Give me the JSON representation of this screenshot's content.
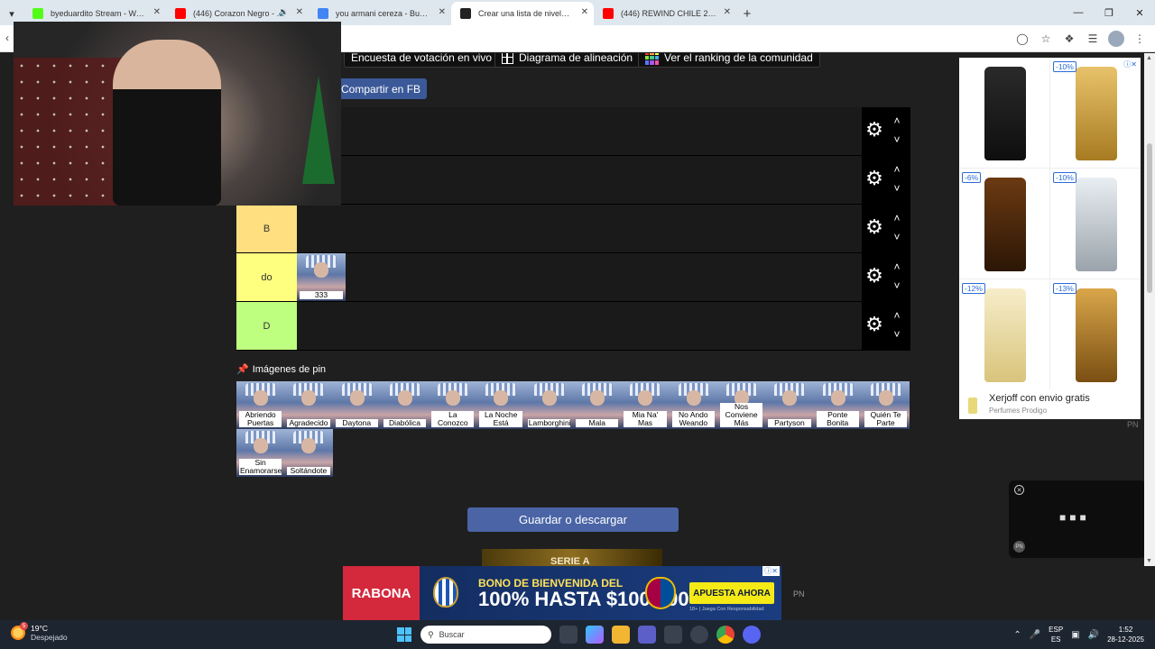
{
  "browser": {
    "tabs": [
      {
        "title": "byeduardito Stream - Watch Li",
        "favicon_color": "#53fc18",
        "active": false
      },
      {
        "title": "(446) Corazon Negro - YouT",
        "favicon_color": "#ff0000",
        "active": false,
        "audio": true
      },
      {
        "title": "you armani cereza - Buscar con",
        "favicon_color": "#4285f4",
        "active": false
      },
      {
        "title": "Crear una lista de niveles de Po",
        "favicon_color": "#222222",
        "active": true
      },
      {
        "title": "(446) REWIND CHILE 2025 - Yo",
        "favicon_color": "#ff0000",
        "active": false
      }
    ]
  },
  "page": {
    "buttons": {
      "poll": "Encuesta de votación en vivo",
      "alignment": "Diagrama de alineación",
      "ranking": "Ver el ranking de la comunidad",
      "fb_share": "Compartir en FB",
      "save": "Guardar o descargar"
    },
    "tiers": [
      {
        "label": "",
        "color": "#1a1a1a",
        "items": []
      },
      {
        "label": "",
        "color": "#1a1a1a",
        "items": []
      },
      {
        "label": "B",
        "color": "#ffdf7f",
        "items": []
      },
      {
        "label": "do",
        "color": "#ffff7f",
        "items": [
          "333"
        ]
      },
      {
        "label": "D",
        "color": "#bfff7f",
        "items": []
      }
    ],
    "pool_title": "Imágenes de pin",
    "pool_items": [
      "Abriendo Puertas",
      "Agradecido",
      "Daytona",
      "Diabólica",
      "La Conozco",
      "La Noche Está",
      "Lamborghini",
      "Mala",
      "Mia Na' Mas",
      "No Ando Weando",
      "Nos Conviene Más",
      "Partyson",
      "Ponte Bonita",
      "Quién Te Parte",
      "Sin Enamorarse",
      "Soltándote"
    ],
    "promo_text": "SERIE A"
  },
  "side_ad": {
    "discounts": [
      "",
      "-10%",
      "-6%",
      "-10%",
      "-12%",
      "-13%"
    ],
    "caption": "Xerjoff con envio gratis",
    "sub": "Perfumes Prodigo",
    "pn": "PN"
  },
  "mini_player": {
    "pn": "PN"
  },
  "bottom_ad": {
    "brand": "RABONA",
    "headline": "BONO DE BIENVENIDA DEL",
    "amount": "100% HASTA $100.000",
    "cta": "APUESTA AHORA",
    "fine": "18+ | Juega Con Responsabilidad",
    "pn": "PN"
  },
  "taskbar": {
    "temp": "19°C",
    "weather": "Despejado",
    "weather_badge": "5",
    "search_placeholder": "Buscar",
    "lang1": "ESP",
    "lang2": "ES",
    "time": "1:52",
    "date": "28-12-2025"
  }
}
